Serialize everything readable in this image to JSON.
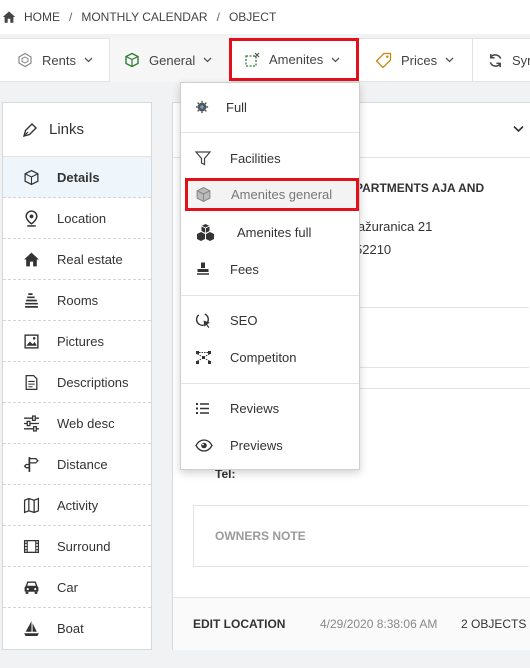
{
  "breadcrumb": {
    "items": [
      "HOME",
      "MONTHLY CALENDAR",
      "OBJECT"
    ],
    "separator": "/"
  },
  "toolbar": {
    "rents": "Rents",
    "general": "General",
    "amenites": "Amenites",
    "prices": "Prices",
    "sync": "Syn"
  },
  "links": {
    "title": "Links",
    "items": [
      "Details",
      "Location",
      "Real estate",
      "Rooms",
      "Pictures",
      "Descriptions",
      "Web desc",
      "Distance",
      "Activity",
      "Surround",
      "Car",
      "Boat"
    ],
    "active": "Details"
  },
  "card": {
    "apartment_name": "PARTMENTS AJA AND",
    "address": "lažuranica 21",
    "zip": "52210",
    "tel_label": "Tel:",
    "owners_note": "OWNERS NOTE",
    "footer": {
      "edit_location": "EDIT LOCATION",
      "timestamp": "4/29/2020 8:38:06 AM",
      "count": "2 OBJECTS"
    }
  },
  "dropdown": {
    "items": [
      "Full",
      "Facilities",
      "Amenites general",
      "Amenites full",
      "Fees",
      "SEO",
      "Competiton",
      "Reviews",
      "Previews"
    ],
    "highlighted": "Amenites general"
  },
  "colors": {
    "highlight_border": "#e3101a",
    "active_link_bg": "#eef6fb"
  }
}
